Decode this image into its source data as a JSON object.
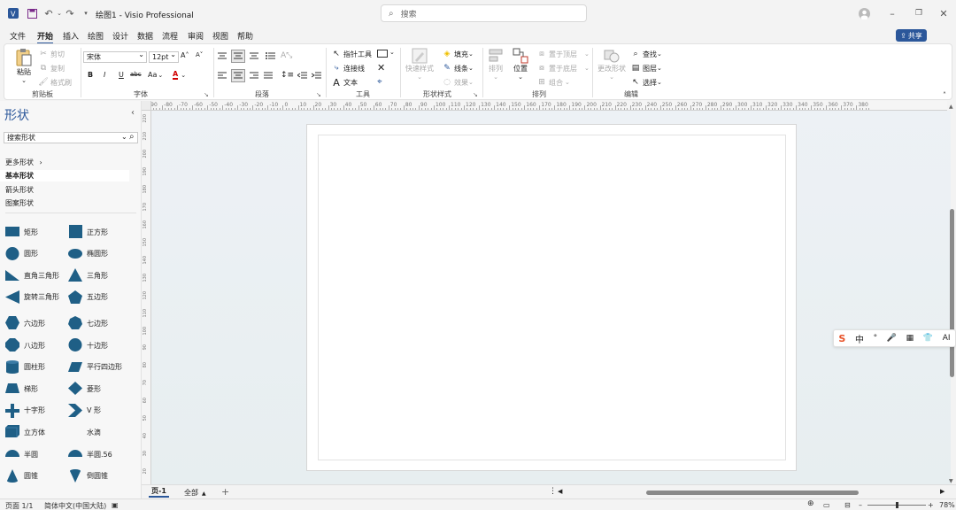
{
  "titlebar": {
    "title": "绘图1 - Visio Professional",
    "search_placeholder": "搜索"
  },
  "menu": {
    "items": [
      "文件",
      "开始",
      "插入",
      "绘图",
      "设计",
      "数据",
      "流程",
      "审阅",
      "视图",
      "帮助"
    ],
    "active": "开始",
    "share_label": "共享"
  },
  "ribbon": {
    "clipboard": {
      "paste": "粘贴",
      "cut": "剪切",
      "copy": "复制",
      "format_painter": "格式刷",
      "label": "剪贴板"
    },
    "font": {
      "name": "宋体",
      "size": "12pt",
      "label": "字体",
      "bold": "B",
      "italic": "I",
      "underline": "U",
      "strike": "abc",
      "case": "Aa",
      "color": "A"
    },
    "paragraph": {
      "label": "段落"
    },
    "tools": {
      "pointer": "指针工具",
      "connector": "连接线",
      "text": "文本",
      "label": "工具"
    },
    "shape_styles": {
      "quick_styles": "快速样式",
      "fill": "填充",
      "line": "线条",
      "effects": "效果",
      "label": "形状样式"
    },
    "arrange": {
      "align": "排列",
      "position": "位置",
      "bring_front": "置于顶层",
      "send_back": "置于底层",
      "group": "组合",
      "label": "排列"
    },
    "editing": {
      "change_shape": "更改形状",
      "find": "查找",
      "layers": "图层",
      "select": "选择",
      "label": "编辑"
    }
  },
  "shapes_pane": {
    "title": "形状",
    "search_placeholder": "搜索形状",
    "more_shapes": "更多形状",
    "stencils": [
      "基本形状",
      "箭头形状",
      "图案形状"
    ],
    "shapes": [
      {
        "label": "矩形",
        "icon": "rectangle"
      },
      {
        "label": "正方形",
        "icon": "square"
      },
      {
        "label": "圆形",
        "icon": "circle"
      },
      {
        "label": "椭圆形",
        "icon": "ellipse"
      },
      {
        "label": "直角三角形",
        "icon": "right-triangle"
      },
      {
        "label": "三角形",
        "icon": "triangle"
      },
      {
        "label": "旋转三角形",
        "icon": "rotated-triangle"
      },
      {
        "label": "五边形",
        "icon": "pentagon"
      },
      {
        "label": "六边形",
        "icon": "hexagon"
      },
      {
        "label": "七边形",
        "icon": "heptagon"
      },
      {
        "label": "八边形",
        "icon": "octagon"
      },
      {
        "label": "十边形",
        "icon": "decagon"
      },
      {
        "label": "圆柱形",
        "icon": "cylinder"
      },
      {
        "label": "平行四边形",
        "icon": "parallelogram"
      },
      {
        "label": "梯形",
        "icon": "trapezoid"
      },
      {
        "label": "菱形",
        "icon": "diamond"
      },
      {
        "label": "十字形",
        "icon": "cross"
      },
      {
        "label": "V 形",
        "icon": "chevron"
      },
      {
        "label": "立方体",
        "icon": "cube"
      },
      {
        "label": "水滴",
        "icon": "drop"
      },
      {
        "label": "半圆",
        "icon": "semicircle"
      },
      {
        "label": "半圆.56",
        "icon": "semicircle"
      },
      {
        "label": "圆锥",
        "icon": "cone"
      },
      {
        "label": "倒圆锥",
        "icon": "inverted-cone"
      }
    ],
    "shape_color": "#1f5f86"
  },
  "ruler": {
    "labels": [
      "-90",
      "-80",
      "-70",
      "-60",
      "-50",
      "-40",
      "-30",
      "-20",
      "-10",
      "0",
      "10",
      "20",
      "30",
      "40",
      "50",
      "60",
      "70",
      "80",
      "90",
      "100",
      "110",
      "120",
      "130",
      "140",
      "150",
      "160",
      "170",
      "180",
      "190",
      "200",
      "210",
      "220",
      "230",
      "240",
      "250",
      "260",
      "270",
      "280",
      "290",
      "300",
      "310",
      "320",
      "330",
      "340",
      "350",
      "360",
      "370",
      "380"
    ]
  },
  "left_ruler_labels": [
    "220",
    "210",
    "200",
    "190",
    "180",
    "170",
    "160",
    "150",
    "140",
    "130",
    "120",
    "110",
    "100",
    "90",
    "80",
    "70",
    "60",
    "50",
    "40",
    "30",
    "20"
  ],
  "tabs": {
    "page": "页-1",
    "all": "全部",
    "add": "+"
  },
  "status": {
    "page": "页面 1/1",
    "language": "简体中文(中国大陆)",
    "zoom": "78%"
  },
  "ime": [
    "S",
    "中",
    "°",
    "🎤",
    "▦",
    "👕",
    "AI"
  ],
  "colors": {
    "accent": "#2b579a",
    "shape": "#1f5f86"
  }
}
